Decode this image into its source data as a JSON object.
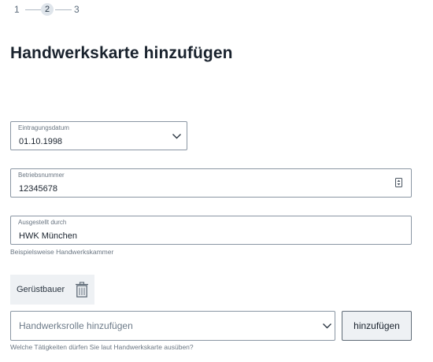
{
  "stepper": {
    "steps": [
      "1",
      "2",
      "3"
    ],
    "active_step": "2"
  },
  "page": {
    "title": "Handwerkskarte hinzufügen"
  },
  "form": {
    "date": {
      "label": "Eintragungsdatum",
      "value": "01.10.1998",
      "icon": "chevron-down-icon"
    },
    "business_number": {
      "label": "Betriebsnummer",
      "value": "12345678",
      "icon": "number-stepper-icon"
    },
    "issued_by": {
      "label": "Ausgestellt durch",
      "value": "HWK München",
      "helper": "Beispielsweise Handwerkskammer"
    },
    "roles": {
      "chips": [
        {
          "label": "Gerüstbauer",
          "icon": "trash-icon"
        }
      ],
      "select_placeholder": "Handwerksrolle hinzufügen",
      "add_button_label": "hinzufügen",
      "helper": "Welche Tätigkeiten dürfen Sie laut Handwerkskarte ausüben?"
    }
  },
  "colors": {
    "border": "#8a96a3",
    "chip_bg": "#eef1f4",
    "button_bg": "#eef1f4",
    "active_step_bg": "#dfe5eb"
  }
}
